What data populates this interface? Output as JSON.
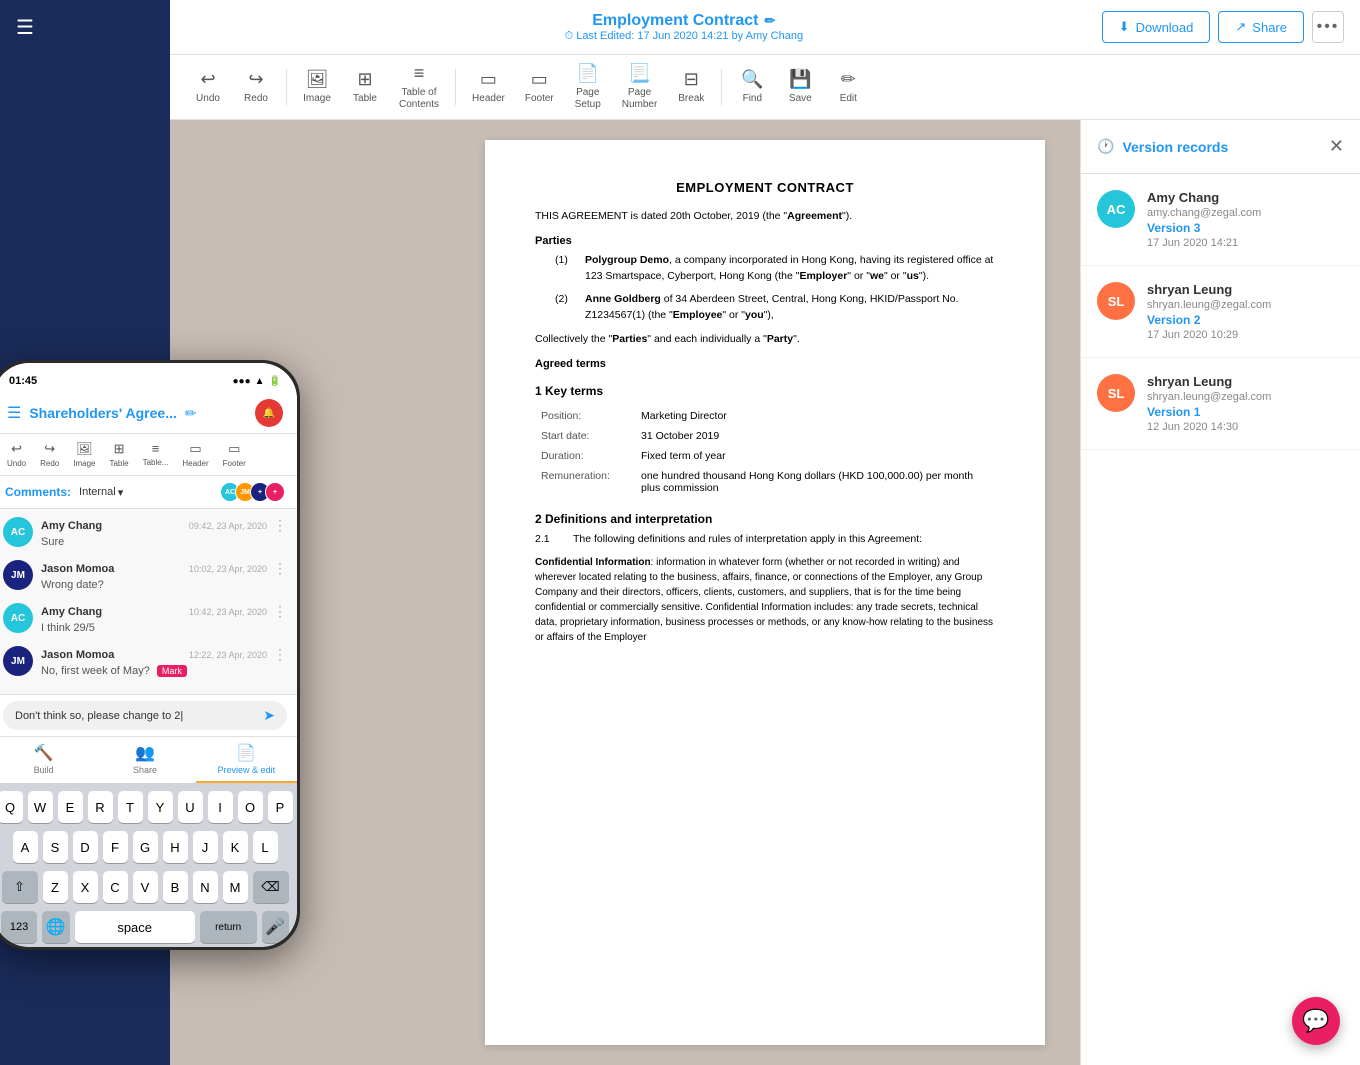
{
  "header": {
    "doc_title": "Employment Contract",
    "pencil_icon": "✏",
    "last_edited": "⏱ Last Edited: 17 Jun 2020 14:21 by Amy Chang",
    "download_label": "Download",
    "share_label": "Share",
    "more_icon": "•••"
  },
  "toolbar": {
    "items": [
      {
        "id": "undo",
        "icon": "↩",
        "label": "Undo"
      },
      {
        "id": "redo",
        "icon": "↪",
        "label": "Redo"
      },
      {
        "id": "image",
        "icon": "🖼",
        "label": "Image"
      },
      {
        "id": "table",
        "icon": "⊞",
        "label": "Table"
      },
      {
        "id": "toc",
        "icon": "≡",
        "label": "Table of\nContents"
      },
      {
        "id": "header",
        "icon": "⬒",
        "label": "Header"
      },
      {
        "id": "footer",
        "icon": "⬓",
        "label": "Footer"
      },
      {
        "id": "page-setup",
        "icon": "📄",
        "label": "Page\nSetup"
      },
      {
        "id": "page-number",
        "icon": "📃",
        "label": "Page\nNumber"
      },
      {
        "id": "break",
        "icon": "⊟",
        "label": "Break"
      },
      {
        "id": "find",
        "icon": "🔍",
        "label": "Find"
      },
      {
        "id": "save",
        "icon": "💾",
        "label": "Save"
      },
      {
        "id": "edit",
        "icon": "✏",
        "label": "Edit"
      }
    ]
  },
  "document": {
    "title": "EMPLOYMENT CONTRACT",
    "paragraph1": "THIS AGREEMENT is dated 20th October, 2019 (the \"Agreement\").",
    "parties_heading": "Parties",
    "party1": "Polygroup Demo, a company incorporated in Hong Kong, having its registered office at 123 Smartspace, Cyberport, Hong Kong (the \"Employer\" or \"we\" or \"us\").",
    "party2": "Anne Goldberg of 34 Aberdeen Street, Central, Hong Kong, HKID/Passport No. Z1234567(1) (the \"Employee\" or \"you\"),",
    "collectively": "Collectively the \"Parties\" and each individually a \"Party\".",
    "agreed_terms": "Agreed terms",
    "section1": "1    Key terms",
    "position_label": "Position:",
    "position_value": "Marketing Director",
    "start_date_label": "Start date:",
    "start_date_value": "31 October 2019",
    "duration_label": "Duration:",
    "duration_value": "Fixed term of  year",
    "remuneration_label": "Remuneration:",
    "remuneration_value": "one hundred thousand Hong Kong dollars (HKD 100,000.00) per month plus commission",
    "section2": "2    Definitions and interpretation",
    "section2_1": "2.1",
    "section2_1_text": "The following definitions and rules of interpretation apply in this Agreement:",
    "confidential_term": "Confidential Information",
    "confidential_def": ": information in whatever form (whether or not recorded in writing) and wherever located relating to the business, affairs, finance, or connections of the Employer, any Group Company and their directors, officers, clients, customers, and suppliers, that is for the time being confidential or commercially sensitive. Confidential Information includes: any trade secrets, technical data, proprietary information, business processes or methods, or any know-how relating to the business or affairs of the Employer"
  },
  "version_records": {
    "title": "Version records",
    "clock_icon": "🕐",
    "close_icon": "✕",
    "items": [
      {
        "initials": "AC",
        "avatar_class": "avatar-ac",
        "name": "Amy Chang",
        "email": "amy.chang@zegal.com",
        "version": "Version 3",
        "date": "17 Jun 2020 14:21"
      },
      {
        "initials": "SL",
        "avatar_class": "avatar-sl",
        "name": "shryan Leung",
        "email": "shryan.leung@zegal.com",
        "version": "Version 2",
        "date": "17 Jun 2020 10:29"
      },
      {
        "initials": "SL",
        "avatar_class": "avatar-sl",
        "name": "shryan Leung",
        "email": "shryan.leung@zegal.com",
        "version": "Version 1",
        "date": "12 Jun 2020 14:30"
      }
    ]
  },
  "phone": {
    "time": "01:45",
    "signal": "●●●",
    "wifi": "WiFi",
    "battery": "🔋",
    "doc_title": "Shareholders' Agree...",
    "hamburger_icon": "☰",
    "pencil_icon": "✏",
    "comments_label": "Comments:",
    "comments_type": "Internal",
    "comments": [
      {
        "initials": "AC",
        "avatar_class": "ca-ac",
        "author": "Amy Chang",
        "time": "09:42, 23 Apr, 2020",
        "text": "Sure"
      },
      {
        "initials": "JM",
        "avatar_class": "ca-jm",
        "author": "Jason Momoa",
        "time": "10:02, 23 Apr, 2020",
        "text": "Wrong date?"
      },
      {
        "initials": "AC",
        "avatar_class": "ca-ac",
        "author": "Amy Chang",
        "time": "10:42, 23 Apr, 2020",
        "text": "I think 29/5"
      },
      {
        "initials": "JM",
        "avatar_class": "ca-jm",
        "author": "Jason Momoa",
        "time": "12:22, 23 Apr, 2020",
        "text": "No, first week of May?",
        "tag": "Mark"
      }
    ],
    "input_placeholder": "Don't think so, please change to 2|",
    "tabs": [
      {
        "label": "Build",
        "icon": "🔨",
        "active": false
      },
      {
        "label": "Share",
        "icon": "👥",
        "active": false
      },
      {
        "label": "Preview & edit",
        "icon": "📄",
        "active": true
      }
    ],
    "keyboard": {
      "row1": [
        "Q",
        "W",
        "E",
        "R",
        "T",
        "Y",
        "U",
        "I",
        "O",
        "P"
      ],
      "row2": [
        "A",
        "S",
        "D",
        "F",
        "G",
        "H",
        "J",
        "K",
        "L"
      ],
      "row3": [
        "Z",
        "X",
        "C",
        "V",
        "B",
        "N",
        "M"
      ],
      "bottom": [
        "123",
        "space",
        "return"
      ]
    }
  }
}
